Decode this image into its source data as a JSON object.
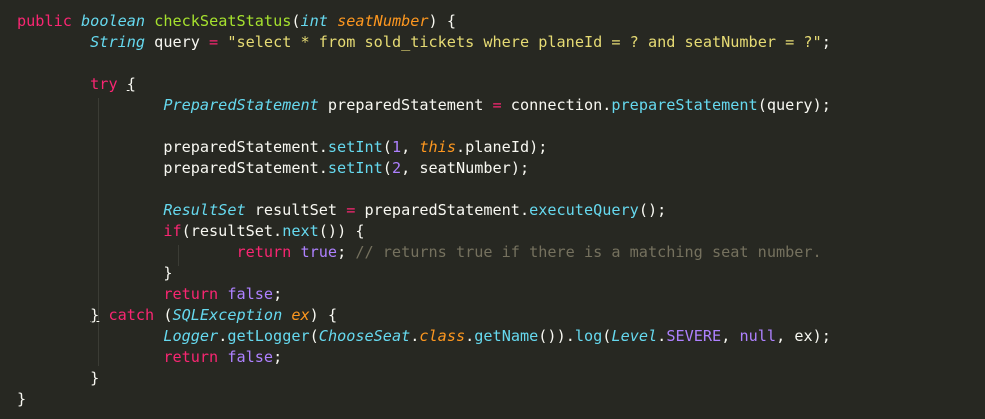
{
  "editor": {
    "theme": "monokai",
    "colors": {
      "background": "#272822",
      "text": "#f8f8f2",
      "keyword": "#f92672",
      "function": "#a6e22e",
      "type": "#66d9ef",
      "parameter": "#fd971f",
      "string": "#e6db74",
      "number": "#ae81ff",
      "comment": "#75715e"
    }
  },
  "code": {
    "l1": {
      "t0": "public",
      "t1": " ",
      "t2": "boolean",
      "t3": " ",
      "t4": "checkSeatStatus",
      "t5": "(",
      "t6": "int",
      "t7": " ",
      "t8": "seatNumber",
      "t9": ") {"
    },
    "l2": {
      "indent": "        ",
      "t0": "String",
      "t1": " query ",
      "t2": "=",
      "t3": " ",
      "t4": "\"select * from sold_tickets where planeId = ? and seatNumber = ?\"",
      "t5": ";"
    },
    "l3": {
      "indent": "        ",
      "t0": "try",
      "t1": " ",
      "t2": "{"
    },
    "l4": {
      "indent": "                ",
      "t0": "PreparedStatement",
      "t1": " preparedStatement ",
      "t2": "=",
      "t3": " connection.",
      "t4": "prepareStatement",
      "t5": "(query);"
    },
    "l5": {
      "indent": "                ",
      "t0": "preparedStatement.",
      "t1": "setInt",
      "t2": "(",
      "t3": "1",
      "t4": ", ",
      "t5": "this",
      "t6": ".planeId);"
    },
    "l6": {
      "indent": "                ",
      "t0": "preparedStatement.",
      "t1": "setInt",
      "t2": "(",
      "t3": "2",
      "t4": ", seatNumber);"
    },
    "l7": {
      "indent": "                ",
      "t0": "ResultSet",
      "t1": " resultSet ",
      "t2": "=",
      "t3": " preparedStatement.",
      "t4": "executeQuery",
      "t5": "();"
    },
    "l8": {
      "indent": "                ",
      "t0": "if",
      "t1": "(resultSet.",
      "t2": "next",
      "t3": "()) {"
    },
    "l9": {
      "indent": "                        ",
      "t0": "return",
      "t1": " ",
      "t2": "true",
      "t3": "; ",
      "t4": "// returns true if there is a matching seat number."
    },
    "l10": {
      "indent": "                ",
      "t0": "}"
    },
    "l11": {
      "indent": "                ",
      "t0": "return",
      "t1": " ",
      "t2": "false",
      "t3": ";"
    },
    "l12": {
      "indent": "        ",
      "t0": "}",
      "t1": " ",
      "t2": "catch",
      "t3": " (",
      "t4": "SQLException",
      "t5": " ",
      "t6": "ex",
      "t7": ") {"
    },
    "l13": {
      "indent": "                ",
      "t0": "Logger",
      "t1": ".",
      "t2": "getLogger",
      "t3": "(",
      "t4": "ChooseSeat",
      "t5": ".",
      "t6": "class",
      "t7": ".",
      "t8": "getName",
      "t9": "()).",
      "t10": "log",
      "t11": "(",
      "t12": "Level",
      "t13": ".",
      "t14": "SEVERE",
      "t15": ", ",
      "t16": "null",
      "t17": ", ex);"
    },
    "l14": {
      "indent": "                ",
      "t0": "return",
      "t1": " ",
      "t2": "false",
      "t3": ";"
    },
    "l15": {
      "indent": "        ",
      "t0": "}"
    },
    "l16": {
      "t0": "}"
    }
  }
}
